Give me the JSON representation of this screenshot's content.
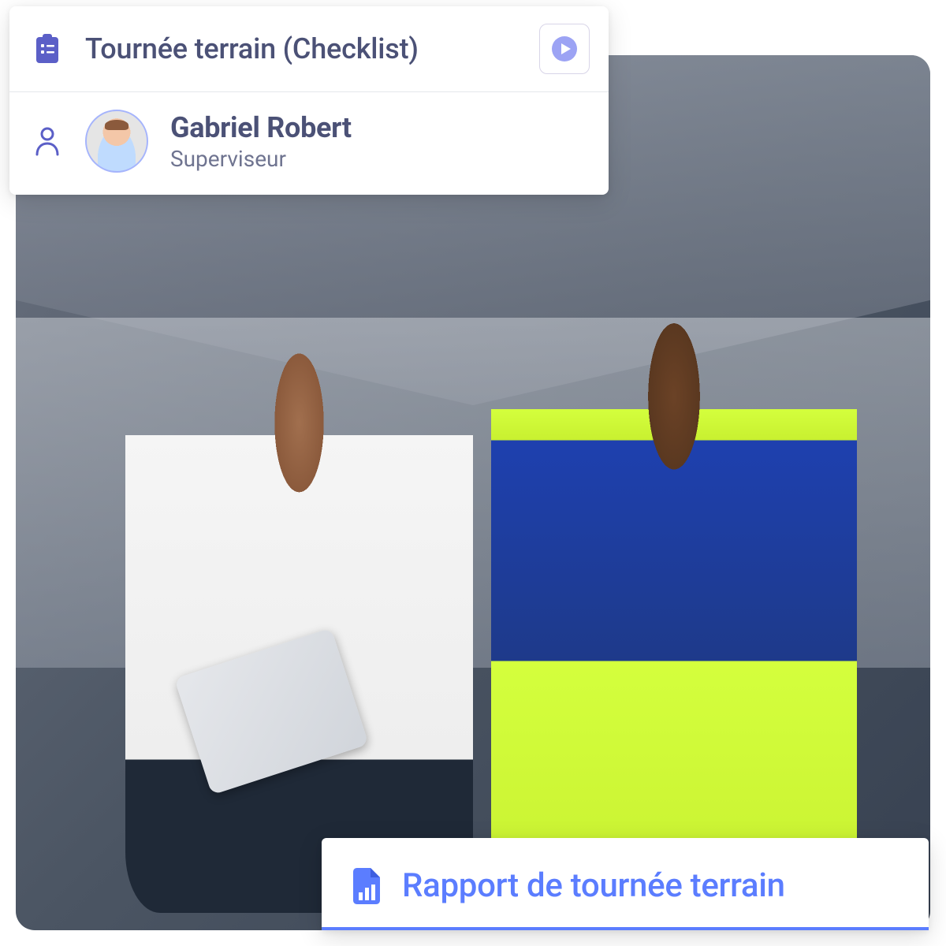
{
  "checklist": {
    "title": "Tournée terrain (Checklist)",
    "user": {
      "name": "Gabriel Robert",
      "role": "Superviseur"
    }
  },
  "report": {
    "title": "Rapport de tournée terrain"
  },
  "colors": {
    "primary": "#5b5fc7",
    "accent": "#5b7dff",
    "text_muted": "#6f7490"
  }
}
